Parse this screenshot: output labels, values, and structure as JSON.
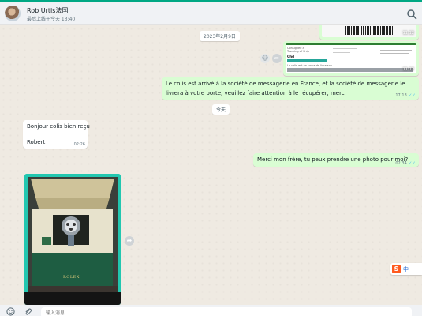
{
  "header": {
    "contact_name": "Rob Urtis法国",
    "contact_status": "最后上线于今天 13:40",
    "search_icon": "search-icon"
  },
  "chat": {
    "date_chip_1": "2023年2月9日",
    "date_chip_2": "今天",
    "image_msg_1": {
      "time": "11:12"
    },
    "image_msg_2": {
      "time": "11:12",
      "doc_lines": [
        "Consignee &",
        "Tracking of Ship",
        "Ghd",
        "Le colis est en cours de livraison"
      ]
    },
    "msg_out_1": {
      "text": "Le colis est arrivé à la société de messagerie en France, et la société de messagerie le livrera à votre porte, veuillez faire attention à le récupérer, merci",
      "time": "17:13"
    },
    "msg_in_1": {
      "line1": "Bonjour colis bien reçu",
      "line2": "Robert",
      "time": "02:26"
    },
    "msg_out_2": {
      "text": "Merci mon frère, tu peux prendre une photo pour moi?",
      "time": "02:34"
    },
    "photo_msg": {
      "brand": "ROLEX"
    }
  },
  "composer": {
    "placeholder": "输入消息"
  },
  "ime": {
    "label": "中"
  },
  "colors": {
    "accent": "#00a884",
    "outgoing_bubble": "#d9fdd3",
    "incoming_bubble": "#ffffff",
    "read_tick": "#53bdeb",
    "background": "#efeae2"
  }
}
